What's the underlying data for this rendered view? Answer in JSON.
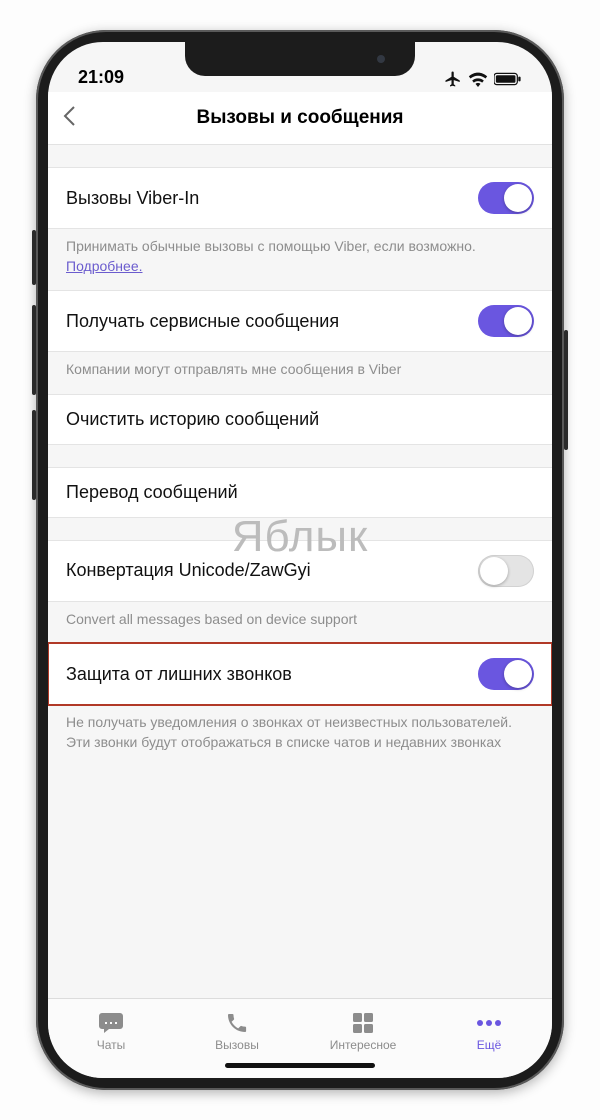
{
  "status": {
    "time": "21:09"
  },
  "navbar": {
    "title": "Вызовы и сообщения"
  },
  "settings": {
    "viberIn": {
      "label": "Вызовы Viber-In",
      "desc_prefix": "Принимать обычные вызовы с помощью Viber, если возможно. ",
      "desc_link": "Подробнее.",
      "on": true
    },
    "serviceMsgs": {
      "label": "Получать сервисные сообщения",
      "desc": "Компании могут отправлять мне сообщения в Viber",
      "on": true
    },
    "clearHistory": {
      "label": "Очистить историю сообщений"
    },
    "translate": {
      "label": "Перевод сообщений"
    },
    "unicode": {
      "label": "Конвертация Unicode/ZawGyi",
      "desc": "Convert all messages based on device support",
      "on": false
    },
    "callProtect": {
      "label": "Защита от лишних звонков",
      "desc": "Не получать уведомления о звонках от неизвестных пользователей. Эти звонки будут отображаться в списке чатов и недавних звонках",
      "on": true
    }
  },
  "watermark": "Яблык",
  "tabs": {
    "chats": "Чаты",
    "calls": "Вызовы",
    "explore": "Интересное",
    "more": "Ещё"
  }
}
